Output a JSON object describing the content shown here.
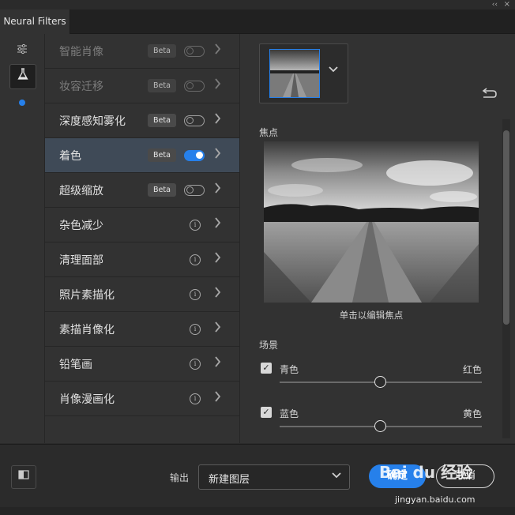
{
  "window": {
    "tab_title": "Neural Filters",
    "collapse_glyph": "‹‹",
    "close_glyph": "×"
  },
  "leftbar": {
    "icons": [
      "sliders-icon",
      "flask-icon"
    ]
  },
  "filters": [
    {
      "label": "智能肖像",
      "badge": "Beta",
      "control": "toggle",
      "on": false,
      "dim": true
    },
    {
      "label": "妆容迁移",
      "badge": "Beta",
      "control": "toggle",
      "on": false,
      "dim": true
    },
    {
      "label": "深度感知雾化",
      "badge": "Beta",
      "control": "toggle",
      "on": false,
      "dim": false
    },
    {
      "label": "着色",
      "badge": "Beta",
      "control": "toggle",
      "on": true,
      "dim": false,
      "selected": true
    },
    {
      "label": "超级缩放",
      "badge": "Beta",
      "control": "toggle",
      "on": false,
      "dim": false
    },
    {
      "label": "杂色减少",
      "control": "info",
      "dim": false
    },
    {
      "label": "清理面部",
      "control": "info",
      "dim": false
    },
    {
      "label": "照片素描化",
      "control": "info",
      "dim": false
    },
    {
      "label": "素描肖像化",
      "control": "info",
      "dim": false
    },
    {
      "label": "铅笔画",
      "control": "info",
      "dim": false
    },
    {
      "label": "肖像漫画化",
      "control": "info",
      "dim": false
    }
  ],
  "panel": {
    "focus_label": "焦点",
    "focus_caption": "单击以编辑焦点",
    "scene_label": "场景",
    "sliders": [
      {
        "left": "青色",
        "right": "红色",
        "checked": true,
        "value": 0.5
      },
      {
        "left": "蓝色",
        "right": "黄色",
        "checked": true,
        "value": 0.5
      }
    ]
  },
  "footer": {
    "output_label": "输出",
    "output_value": "新建图层",
    "ok_label": "确定",
    "cancel_label": "取消"
  },
  "watermark": {
    "logo": "Bai du 经验",
    "url": "jingyan.baidu.com"
  },
  "colors": {
    "accent": "#2680eb",
    "panel_bg": "#323232",
    "selected_row": "#3f4a57"
  }
}
